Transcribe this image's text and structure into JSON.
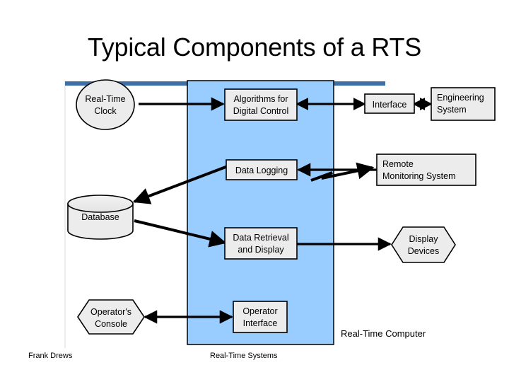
{
  "slide": {
    "title": "Typical Components of a RTS",
    "footer_author": "Frank Drews",
    "footer_course": "Real-Time Systems"
  },
  "colors": {
    "boundary_fill": "#99ccff",
    "boundary_stroke": "#000000",
    "accent_bar": "#3d6ea5",
    "node_fill": "#ececec",
    "node_stroke": "#000000",
    "arrow": "#000000",
    "title_text": "#000000"
  },
  "diagram": {
    "boundary_label": "Real-Time Computer",
    "nodes": {
      "real_time_clock": {
        "label_line1": "Real-Time",
        "label_line2": "Clock",
        "shape": "ellipse"
      },
      "database": {
        "label": "Database",
        "shape": "cylinder"
      },
      "operators_console": {
        "label_line1": "Operator's",
        "label_line2": "Console",
        "shape": "hexagon"
      },
      "algorithms": {
        "label_line1": "Algorithms for",
        "label_line2": "Digital Control",
        "shape": "rect"
      },
      "data_logging": {
        "label": "Data Logging",
        "shape": "rect"
      },
      "data_retrieval": {
        "label_line1": "Data Retrieval",
        "label_line2": "and Display",
        "shape": "rect"
      },
      "operator_interface": {
        "label_line1": "Operator",
        "label_line2": "Interface",
        "shape": "rect"
      },
      "interface": {
        "label": "Interface",
        "shape": "rect"
      },
      "engineering_system": {
        "label_line1": "Engineering",
        "label_line2": "System",
        "shape": "rect"
      },
      "remote_monitoring": {
        "label_line1": "Remote",
        "label_line2": "Monitoring System",
        "shape": "rect"
      },
      "display_devices": {
        "label_line1": "Display",
        "label_line2": "Devices",
        "shape": "hexagon"
      }
    },
    "connections": [
      {
        "name": "clock-to-algorithms",
        "from": "real_time_clock",
        "to": "algorithms",
        "arrow": "single"
      },
      {
        "name": "algorithms-to-interface",
        "from": "algorithms",
        "to": "interface",
        "arrow": "double"
      },
      {
        "name": "interface-to-engineering-system",
        "from": "interface",
        "to": "engineering_system",
        "arrow": "double"
      },
      {
        "name": "data-logging-to-database",
        "from": "data_logging",
        "to": "database",
        "arrow": "single"
      },
      {
        "name": "remote-monitoring-to-data-logging",
        "from": "remote_monitoring",
        "to": "data_logging",
        "arrow": "single"
      },
      {
        "name": "data-logging-to-remote-monitoring-wireless",
        "from": "data_logging",
        "to": "remote_monitoring",
        "arrow": "zigzag"
      },
      {
        "name": "database-to-data-retrieval",
        "from": "database",
        "to": "data_retrieval",
        "arrow": "single"
      },
      {
        "name": "data-retrieval-to-display-devices",
        "from": "data_retrieval",
        "to": "display_devices",
        "arrow": "single"
      },
      {
        "name": "operators-console-to-operator-interface",
        "from": "operators_console",
        "to": "operator_interface",
        "arrow": "double"
      }
    ]
  }
}
